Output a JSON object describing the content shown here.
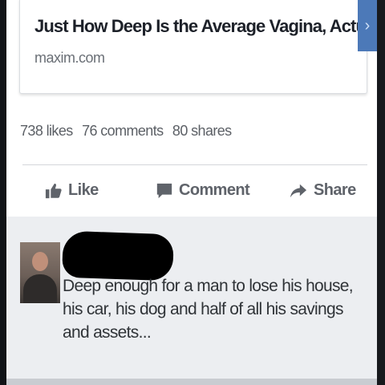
{
  "link_preview": {
    "title": "Just How Deep Is the Average Vagina, Actually?",
    "domain": "maxim.com",
    "next_icon": "chevron-right-icon"
  },
  "stats": {
    "likes": "738 likes",
    "comments": "76 comments",
    "shares": "80 shares"
  },
  "actions": {
    "like_label": "Like",
    "comment_label": "Comment",
    "share_label": "Share"
  },
  "comment": {
    "text": "Deep enough for a man to lose his house, his car, his dog and half of all his savings and assets..."
  },
  "colors": {
    "accent": "#4c79b8",
    "action_gray": "#5f636a"
  }
}
